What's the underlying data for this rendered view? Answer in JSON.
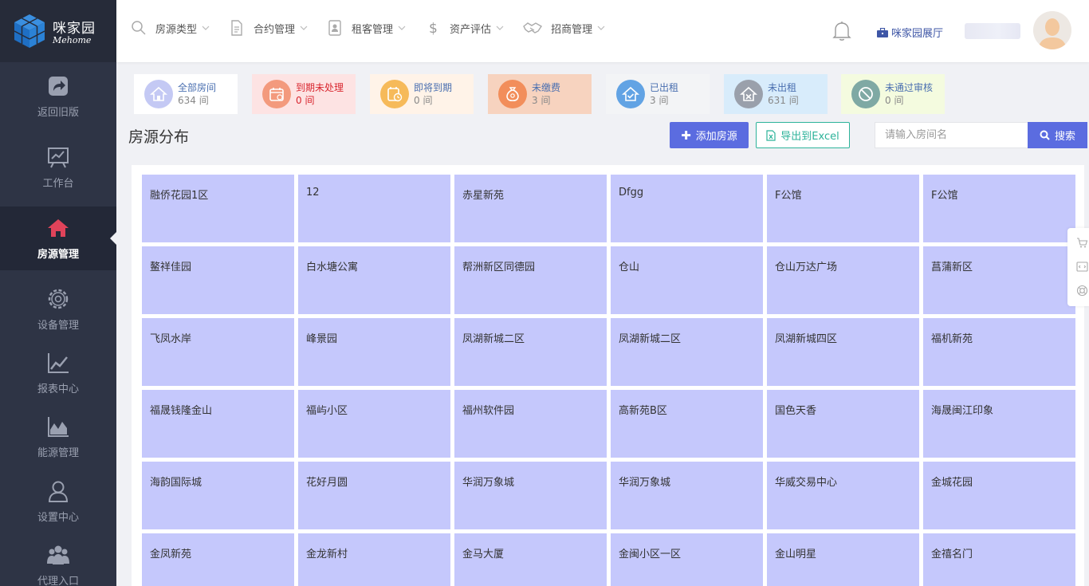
{
  "brand": {
    "name_cn": "咪家园",
    "name_en": "Mehome"
  },
  "sidebar": {
    "items": [
      {
        "label": "返回旧版",
        "icon": "share-arrow-icon"
      },
      {
        "label": "工作台",
        "icon": "chart-board-icon"
      },
      {
        "label": "房源管理",
        "icon": "home-icon",
        "active": true
      },
      {
        "label": "设备管理",
        "icon": "gear-icon"
      },
      {
        "label": "报表中心",
        "icon": "line-chart-icon"
      },
      {
        "label": "能源管理",
        "icon": "area-chart-icon"
      },
      {
        "label": "设置中心",
        "icon": "user-icon"
      },
      {
        "label": "代理入口",
        "icon": "group-icon"
      }
    ]
  },
  "topnav": {
    "items": [
      {
        "label": "房源类型",
        "icon": "search-icon"
      },
      {
        "label": "合约管理",
        "icon": "document-icon"
      },
      {
        "label": "租客管理",
        "icon": "contact-card-icon"
      },
      {
        "label": "资产评估",
        "icon": "dollar-icon"
      },
      {
        "label": "招商管理",
        "icon": "handshake-icon"
      }
    ],
    "hall_link": "咪家园展厅"
  },
  "stats": [
    {
      "label": "全部房间",
      "count": "634 间",
      "bg": "#ffffff",
      "icon_bg": "#c4c9f4",
      "icon": "house-icon"
    },
    {
      "label": "到期未处理",
      "count": "0 间",
      "bg": "#fde3e3",
      "icon_bg": "#f39a7d",
      "icon": "calendar-icon",
      "alert": true
    },
    {
      "label": "即将到期",
      "count": "0 间",
      "bg": "#fff3e8",
      "icon_bg": "#f6ba5a",
      "icon": "calendar-clock-icon"
    },
    {
      "label": "未缴费",
      "count": "3 间",
      "bg": "#f7d3bf",
      "icon_bg": "#f28e5b",
      "icon": "money-bag-icon"
    },
    {
      "label": "已出租",
      "count": "3 间",
      "bg": "#f3f4f6",
      "icon_bg": "#62a3e4",
      "icon": "house-check-icon"
    },
    {
      "label": "未出租",
      "count": "631 间",
      "bg": "#d8ecfb",
      "icon_bg": "#9aa0ab",
      "icon": "house-x-icon"
    },
    {
      "label": "未通过审核",
      "count": "0 间",
      "bg": "#f4fbdf",
      "icon_bg": "#7fa9a4",
      "icon": "forbidden-icon"
    }
  ],
  "section": {
    "title": "房源分布",
    "add_button": "添加房源",
    "export_button": "导出到Excel",
    "search_placeholder": "请输入房间名",
    "search_button": "搜索"
  },
  "properties": [
    "融侨花园1区",
    "12",
    "赤星新苑",
    "Dfgg",
    "F公馆",
    "F公馆",
    "鳌祥佳园",
    "白水塘公寓",
    "帮洲新区同德园",
    "仓山",
    "仓山万达广场",
    "菖蒲新区",
    "飞凤水岸",
    "峰景园",
    "凤湖新城二区",
    "凤湖新城二区",
    "凤湖新城四区",
    "福机新苑",
    "福晟钱隆金山",
    "福屿小区",
    "福州软件园",
    "高新苑B区",
    "国色天香",
    "海晟闽江印象",
    "海韵国际城",
    "花好月圆",
    "华润万象城",
    "华润万象城",
    "华威交易中心",
    "金城花园",
    "金凤新苑",
    "金龙新村",
    "金马大厦",
    "金闽小区一区",
    "金山明星",
    "金禧名门"
  ],
  "colors": {
    "accent": "#5b6ce0",
    "tile": "#c5c8fc",
    "sidebar": "#2e3445",
    "active_icon": "#e0435a",
    "export": "#2db39a"
  }
}
